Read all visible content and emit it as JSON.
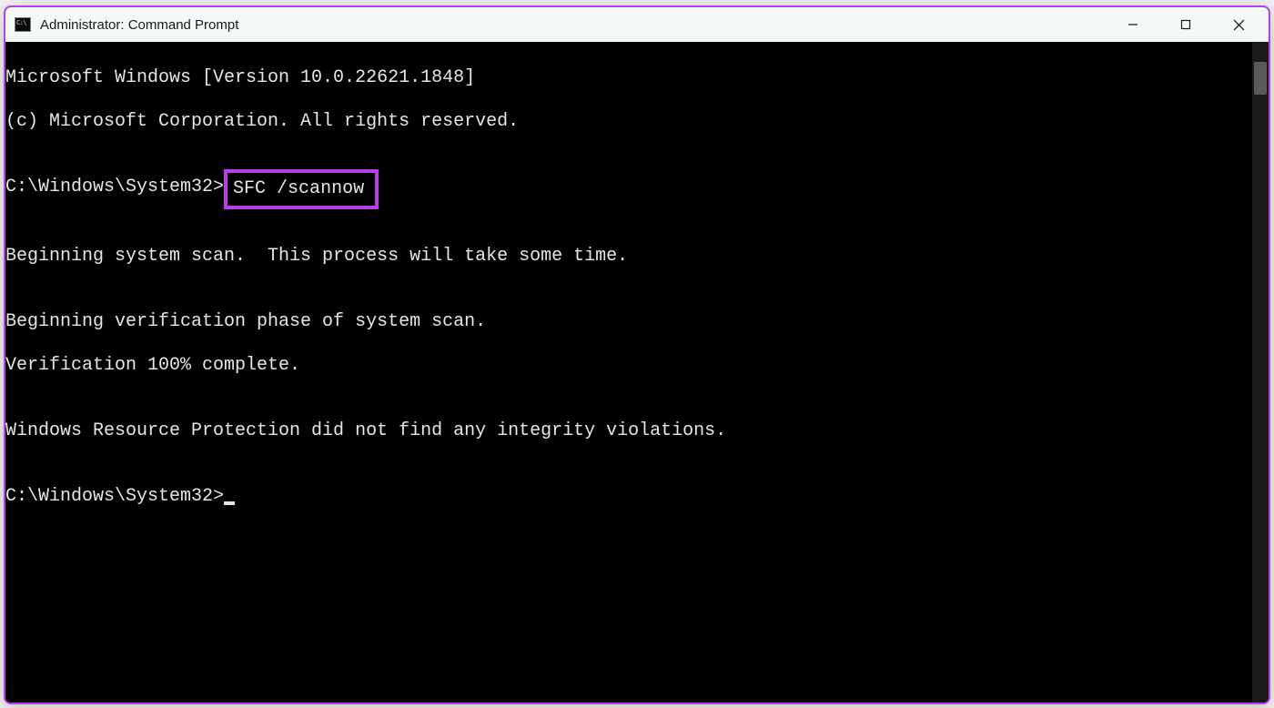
{
  "titlebar": {
    "icon_name": "cmd-icon",
    "title": "Administrator: Command Prompt"
  },
  "window_controls": {
    "minimize": "minimize",
    "maximize": "maximize",
    "close": "close"
  },
  "terminal": {
    "line1": "Microsoft Windows [Version 10.0.22621.1848]",
    "line2": "(c) Microsoft Corporation. All rights reserved.",
    "blank": "",
    "prompt1_path": "C:\\Windows\\System32>",
    "prompt1_command": "SFC /scannow",
    "scan_begin": "Beginning system scan.  This process will take some time.",
    "verify_phase": "Beginning verification phase of system scan.",
    "verify_done": "Verification 100% complete.",
    "result": "Windows Resource Protection did not find any integrity violations.",
    "prompt2_path": "C:\\Windows\\System32>"
  },
  "highlight_color": "#b93fe8"
}
